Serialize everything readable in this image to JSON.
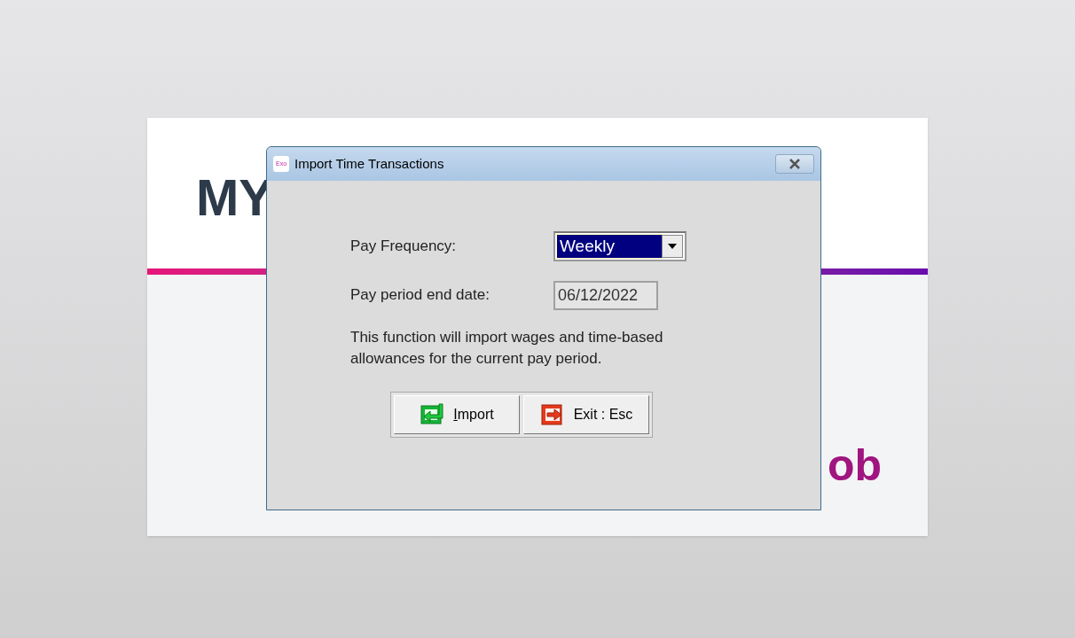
{
  "background": {
    "logo_left": "MY",
    "logo_right": "ob"
  },
  "dialog": {
    "app_icon": "Exo",
    "title": "Import Time Transactions",
    "fields": [
      {
        "kind": "dropdown",
        "label": "Pay Frequency:",
        "value": "Weekly",
        "selected": true
      },
      {
        "kind": "text",
        "label": "Pay period end date:",
        "value": "06/12/2022",
        "selected": false
      }
    ],
    "description": "This function will import wages and time-based allowances for the current pay period.",
    "buttons": [
      {
        "kind": "import",
        "label": "Import",
        "first_letter_underlined": true
      },
      {
        "kind": "exit",
        "label": "Exit : Esc"
      }
    ]
  }
}
